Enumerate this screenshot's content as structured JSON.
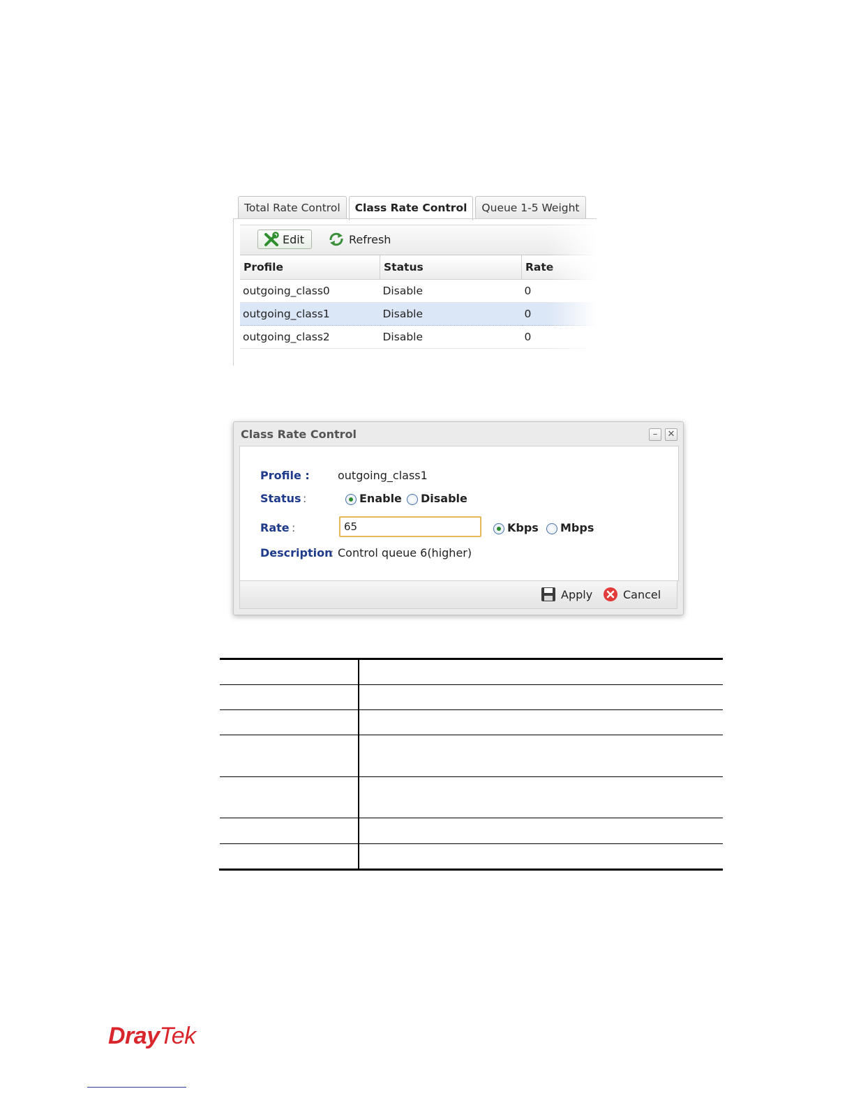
{
  "tabs": [
    {
      "label": "Total Rate Control",
      "active": false
    },
    {
      "label": "Class Rate Control",
      "active": true
    },
    {
      "label": "Queue 1-5 Weight",
      "active": false
    }
  ],
  "toolbar": {
    "edit_label": "Edit",
    "refresh_label": "Refresh",
    "edit_icon": "tools-icon",
    "refresh_icon": "refresh-icon"
  },
  "grid": {
    "columns": [
      "Profile",
      "Status",
      "Rate"
    ],
    "rows": [
      {
        "profile": "outgoing_class0",
        "status": "Disable",
        "rate": "0"
      },
      {
        "profile": "outgoing_class1",
        "status": "Disable",
        "rate": "0",
        "selected": true
      },
      {
        "profile": "outgoing_class2",
        "status": "Disable",
        "rate": "0"
      }
    ]
  },
  "dialog": {
    "title": "Class Rate Control",
    "minimize": "–",
    "close": "✕",
    "profile_label": "Profile :",
    "profile_value": "outgoing_class1",
    "status_label": "Status",
    "colon": ":",
    "status_options": [
      "Enable",
      "Disable"
    ],
    "status_selected": "Enable",
    "rate_label": "Rate",
    "rate_value": "65",
    "unit_options": [
      "Kbps",
      "Mbps"
    ],
    "unit_selected": "Kbps",
    "description_label": "Description",
    "description_value": "Control queue 6(higher)",
    "apply_label": "Apply",
    "cancel_label": "Cancel"
  },
  "colors": {
    "accent_label": "#1e3a8a",
    "selected_row": "#dbe6f6",
    "brand_red": "#d8262c"
  },
  "logo": {
    "part1": "Dray",
    "part2": "Tek"
  }
}
